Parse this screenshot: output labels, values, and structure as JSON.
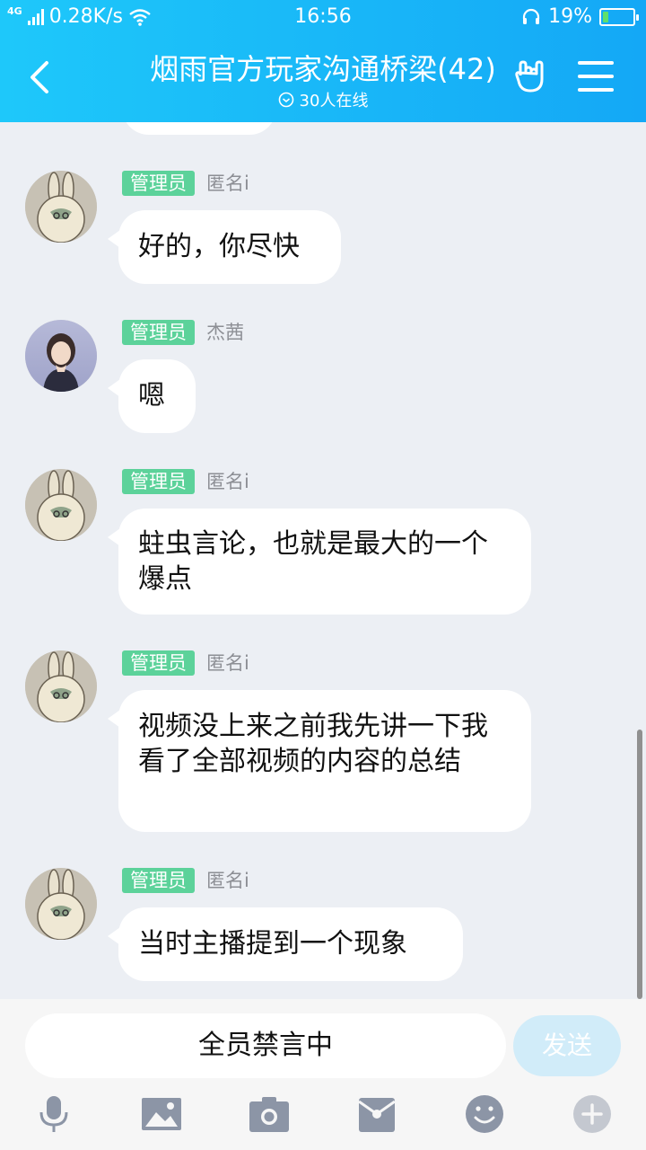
{
  "status_bar": {
    "network": "4G",
    "speed": "0.28K/s",
    "time": "16:56",
    "battery": "19%",
    "battery_level": 0.19
  },
  "header": {
    "title": "烟雨官方玩家沟通桥梁(42)",
    "online": "30人在线"
  },
  "messages": [
    {
      "badge": "管理员",
      "sender": "匿名i",
      "avatar": "bunny-avatar",
      "text": "好的，你尽快"
    },
    {
      "badge": "管理员",
      "sender": "杰茜",
      "avatar": "girl-photo-avatar",
      "text": "嗯"
    },
    {
      "badge": "管理员",
      "sender": "匿名i",
      "avatar": "bunny-avatar",
      "text": "蛀虫言论，也就是最大的一个爆点"
    },
    {
      "badge": "管理员",
      "sender": "匿名i",
      "avatar": "bunny-avatar",
      "text": "视频没上来之前我先讲一下我看了全部视频的内容的总结"
    },
    {
      "badge": "管理员",
      "sender": "匿名i",
      "avatar": "bunny-avatar",
      "text": "当时主播提到一个现象"
    }
  ],
  "input": {
    "placeholder": "全员禁言中",
    "send_label": "发送"
  },
  "toolbar": [
    "mic-icon",
    "image-icon",
    "camera-icon",
    "red-packet-icon",
    "emoji-icon",
    "plus-icon"
  ],
  "colors": {
    "header_start": "#1ec8fa",
    "header_end": "#14a8f6",
    "badge": "#5cd29a",
    "chat_bg": "#eceff4"
  }
}
